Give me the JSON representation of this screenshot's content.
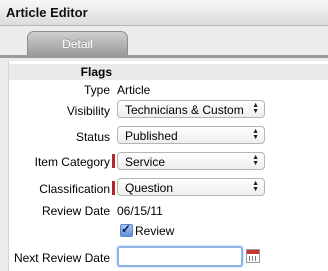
{
  "window": {
    "title": "Article Editor"
  },
  "tabs": [
    {
      "label": "Detail"
    }
  ],
  "form": {
    "section_label": "Flags",
    "type": {
      "label": "Type",
      "value": "Article"
    },
    "visibility": {
      "label": "Visibility",
      "value": "Technicians & Customers"
    },
    "status": {
      "label": "Status",
      "value": "Published"
    },
    "item_category": {
      "label": "Item Category",
      "value": "Service"
    },
    "classification": {
      "label": "Classification",
      "value": "Question"
    },
    "review_date": {
      "label": "Review Date",
      "value": "06/15/11"
    },
    "review_checkbox": {
      "label": "Review",
      "checked": true
    },
    "next_review_date": {
      "label": "Next Review Date",
      "value": "",
      "placeholder": ""
    }
  },
  "colors": {
    "required_marker": "#b3262b",
    "focus_ring": "#8fb4e6"
  }
}
